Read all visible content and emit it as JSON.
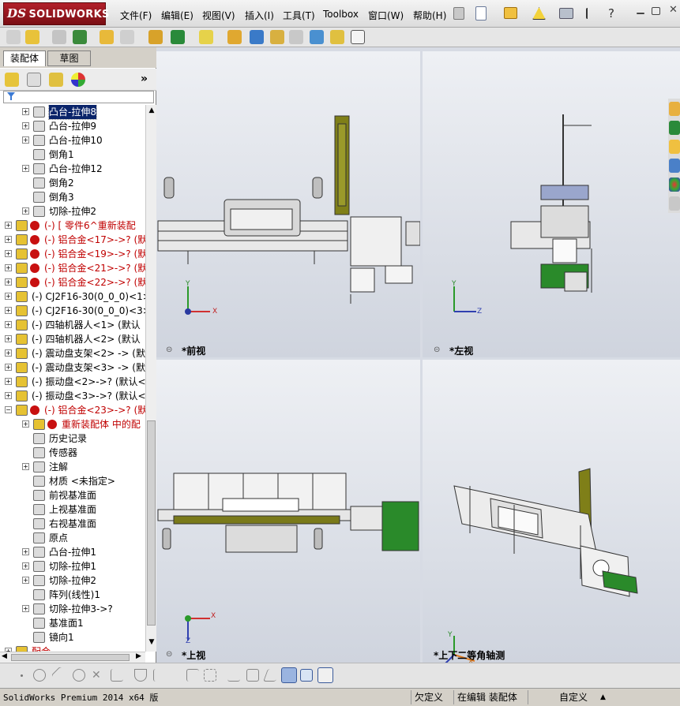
{
  "app": {
    "brand_mark": "DS",
    "brand": "SOLIDWORKS"
  },
  "menu": [
    "文件(F)",
    "编辑(E)",
    "视图(V)",
    "插入(I)",
    "工具(T)",
    "Toolbox",
    "窗口(W)",
    "帮助(H)"
  ],
  "tabs": {
    "assembly": "装配体",
    "sketch": "草图"
  },
  "fm_toolbar": {
    "expand": "»"
  },
  "filter": {
    "icon": "funnel-icon",
    "value": ""
  },
  "tree": [
    {
      "label": "凸台-拉伸8",
      "red": false,
      "selected": true,
      "level": 2
    },
    {
      "label": "凸台-拉伸9",
      "red": false,
      "level": 2
    },
    {
      "label": "凸台-拉伸10",
      "red": false,
      "level": 2
    },
    {
      "label": "倒角1",
      "red": false,
      "level": 2,
      "noexp": true
    },
    {
      "label": "凸台-拉伸12",
      "red": false,
      "level": 2
    },
    {
      "label": "倒角2",
      "red": false,
      "level": 2,
      "noexp": true
    },
    {
      "label": "倒角3",
      "red": false,
      "level": 2,
      "noexp": true
    },
    {
      "label": "切除-拉伸2",
      "red": false,
      "level": 2
    },
    {
      "label": "(-) [ 零件6^重新装配",
      "red": true,
      "level": 1,
      "warn": true
    },
    {
      "label": "(-) 铝合金<17>->?  (默",
      "red": true,
      "level": 1,
      "warn": true
    },
    {
      "label": "(-) 铝合金<19>->?  (默",
      "red": true,
      "level": 1,
      "warn": true
    },
    {
      "label": "(-) 铝合金<21>->?  (默",
      "red": true,
      "level": 1,
      "warn": true
    },
    {
      "label": "(-) 铝合金<22>->?  (默",
      "red": true,
      "level": 1,
      "warn": true
    },
    {
      "label": "(-) CJ2F16-30(0_0_0)<1>",
      "red": false,
      "level": 1
    },
    {
      "label": "(-) CJ2F16-30(0_0_0)<3>",
      "red": false,
      "level": 1
    },
    {
      "label": "(-) 四轴机器人<1> (默认",
      "red": false,
      "level": 1
    },
    {
      "label": "(-) 四轴机器人<2> (默认",
      "red": false,
      "level": 1
    },
    {
      "label": "(-) 震动盘支架<2> -> (默",
      "red": false,
      "level": 1
    },
    {
      "label": "(-) 震动盘支架<3> -> (默",
      "red": false,
      "level": 1
    },
    {
      "label": "(-) 振动盘<2>->?  (默认<",
      "red": false,
      "level": 1
    },
    {
      "label": "(-) 振动盘<3>->?  (默认<",
      "red": false,
      "level": 1
    },
    {
      "label": "(-) 铝合金<23>->?  (默",
      "red": true,
      "level": 1,
      "warn": true,
      "open": true
    },
    {
      "label": "重新装配体 中的配",
      "red": true,
      "level": 2,
      "warn": true
    },
    {
      "label": "历史记录",
      "red": false,
      "level": 2,
      "noexp": true
    },
    {
      "label": "传感器",
      "red": false,
      "level": 2,
      "noexp": true
    },
    {
      "label": "注解",
      "red": false,
      "level": 2
    },
    {
      "label": "材质 <未指定>",
      "red": false,
      "level": 2,
      "noexp": true
    },
    {
      "label": "前视基准面",
      "red": false,
      "level": 2,
      "noexp": true
    },
    {
      "label": "上视基准面",
      "red": false,
      "level": 2,
      "noexp": true
    },
    {
      "label": "右视基准面",
      "red": false,
      "level": 2,
      "noexp": true
    },
    {
      "label": "原点",
      "red": false,
      "level": 2,
      "noexp": true
    },
    {
      "label": "凸台-拉伸1",
      "red": false,
      "level": 2
    },
    {
      "label": "切除-拉伸1",
      "red": false,
      "level": 2
    },
    {
      "label": "切除-拉伸2",
      "red": false,
      "level": 2
    },
    {
      "label": "阵列(线性)1",
      "red": false,
      "level": 2,
      "noexp": true
    },
    {
      "label": "切除-拉伸3->?",
      "red": false,
      "level": 2
    },
    {
      "label": "基准面1",
      "red": false,
      "level": 2,
      "noexp": true
    },
    {
      "label": "镜向1",
      "red": false,
      "level": 2,
      "noexp": true
    },
    {
      "label": "配合",
      "red": true,
      "level": 1,
      "partial": true
    }
  ],
  "views": {
    "front": "*前视",
    "left": "*左视",
    "top": "*上视",
    "iso": "*上下二等角轴测"
  },
  "axes": {
    "x": "X",
    "y": "Y",
    "z": "Z"
  },
  "status": {
    "product": "SolidWorks Premium 2014 x64 版",
    "state1": "欠定义",
    "state2": "在编辑 装配体",
    "units": "自定义",
    "arrow": "▲"
  },
  "colors": {
    "accent_red": "#c00000",
    "part_yellow": "#e2c830",
    "green_part": "#2a8a2a",
    "olive": "#8a8a1a"
  }
}
